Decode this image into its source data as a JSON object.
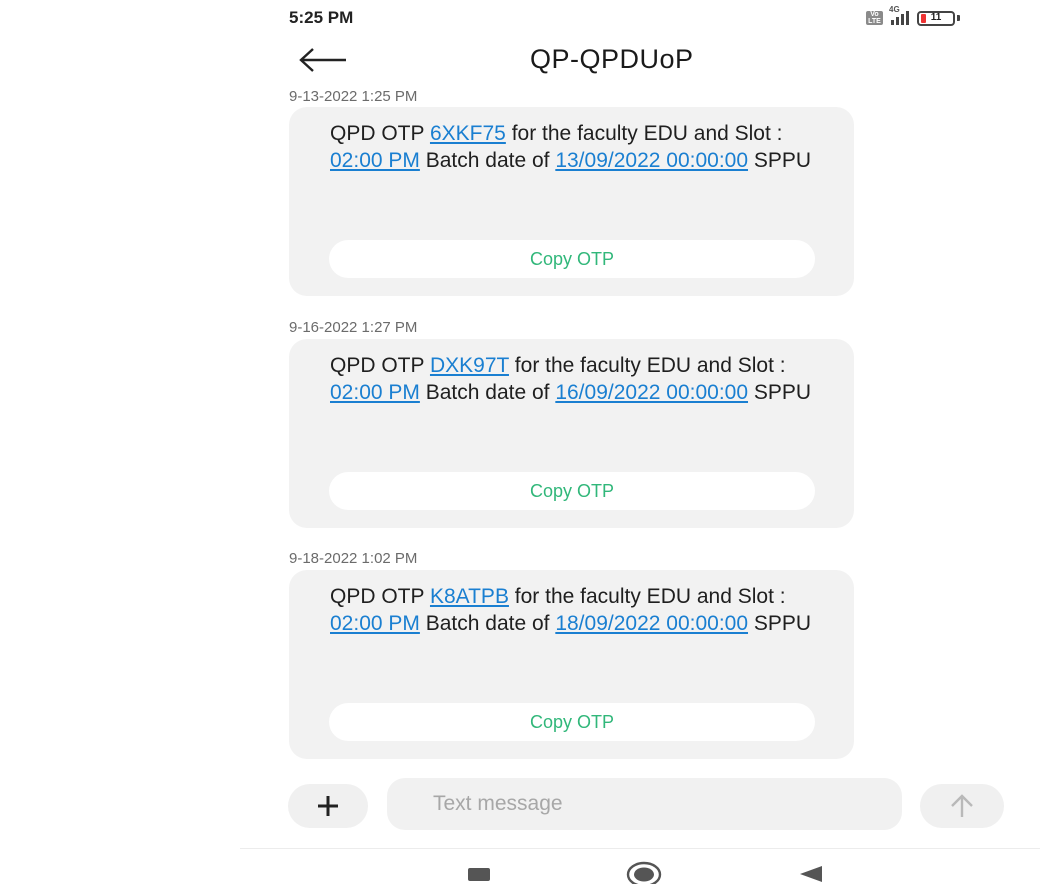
{
  "status_bar": {
    "time": "5:25 PM",
    "volte_label": "Vo LTE",
    "network_label": "4G",
    "battery_level": "11",
    "battery_color": "#e33333"
  },
  "header": {
    "title": "QP-QPDUoP",
    "back_icon": "arrow-left-icon"
  },
  "messages": [
    {
      "timestamp": "9-13-2022 1:25 PM",
      "prefix": "QPD OTP ",
      "otp": "6XKF75",
      "mid": " for the faculty EDU and Slot : ",
      "slot": "02:00 PM",
      "batch": " Batch date of ",
      "date": "13/09/2022 00:00:00",
      "suffix": " SPPU",
      "copy_label": "Copy OTP"
    },
    {
      "timestamp": "9-16-2022 1:27 PM",
      "prefix": "QPD OTP ",
      "otp": "DXK97T",
      "mid": " for the faculty EDU and Slot : ",
      "slot": "02:00 PM",
      "batch": " Batch date of ",
      "date": "16/09/2022 00:00:00",
      "suffix": " SPPU",
      "copy_label": "Copy OTP"
    },
    {
      "timestamp": "9-18-2022 1:02 PM",
      "prefix": "QPD OTP ",
      "otp": "K8ATPB",
      "mid": " for the faculty EDU and Slot : ",
      "slot": "02:00 PM",
      "batch": " Batch date of ",
      "date": "18/09/2022 00:00:00",
      "suffix": " SPPU",
      "copy_label": "Copy OTP"
    }
  ],
  "composer": {
    "placeholder": "Text message",
    "add_icon": "plus-icon",
    "send_icon": "arrow-up-icon"
  },
  "colors": {
    "link": "#1a7fd1",
    "copy_text": "#31b77a",
    "bubble_bg": "#f2f2f2"
  },
  "nav_bar": {
    "recents_icon": "square-icon",
    "home_icon": "circle-icon",
    "back_icon": "triangle-back-icon"
  }
}
